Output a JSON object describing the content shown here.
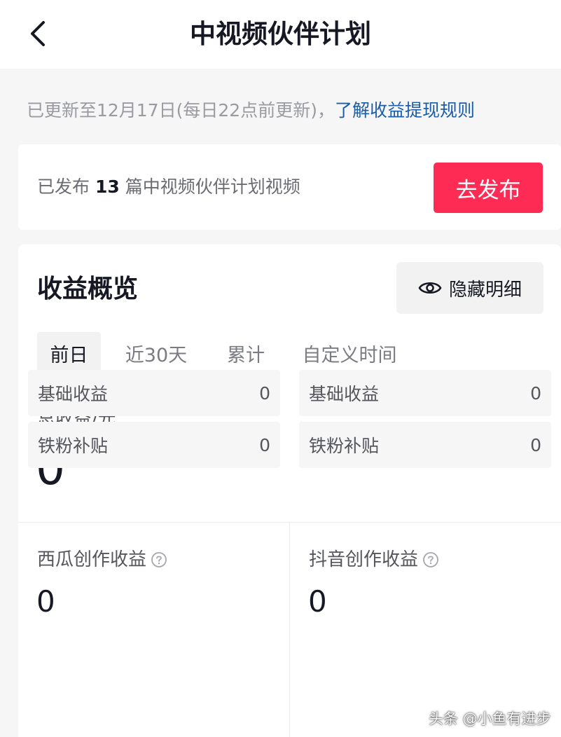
{
  "header": {
    "title": "中视频伙伴计划"
  },
  "notice": {
    "update_text": "已更新至12月17日(每日22点前更新)，",
    "rule_link": "了解收益提现规则"
  },
  "publish": {
    "prefix": "已发布 ",
    "count": "13",
    "suffix": " 篇中视频伙伴计划视频",
    "button_label": "去发布"
  },
  "revenue": {
    "title": "收益概览",
    "hide_label": "隐藏明细",
    "tabs": [
      {
        "label": "前日",
        "active": true
      },
      {
        "label": "近30天",
        "active": false
      },
      {
        "label": "累计",
        "active": false
      },
      {
        "label": "自定义时间",
        "active": false
      }
    ],
    "total_label": "总收益/元",
    "total_value": "0",
    "columns": [
      {
        "label": "西瓜创作收益",
        "value": "0",
        "rows": [
          {
            "name": "基础收益",
            "value": "0"
          },
          {
            "name": "铁粉补贴",
            "value": "0"
          }
        ]
      },
      {
        "label": "抖音创作收益",
        "value": "0",
        "rows": [
          {
            "name": "基础收益",
            "value": "0"
          },
          {
            "name": "铁粉补贴",
            "value": "0"
          }
        ]
      }
    ]
  },
  "watermark": "头条 @小鱼有进步",
  "colors": {
    "primary_button": "#fe2c55",
    "link": "#1c5da8",
    "background": "#f6f6f6"
  },
  "icons": {
    "back": "chevron-left-icon",
    "hide": "eye-icon",
    "help": "question-circle-icon"
  }
}
